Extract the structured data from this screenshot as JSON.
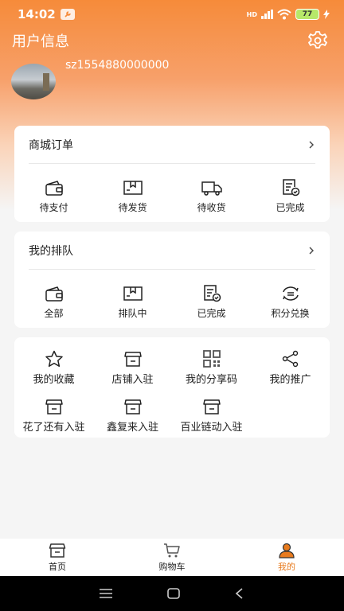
{
  "status_bar": {
    "time": "14:02",
    "network": "HD",
    "battery": "77"
  },
  "header": {
    "title": "用户信息",
    "username": "sz1554880000000"
  },
  "orders": {
    "title": "商城订单",
    "items": [
      {
        "label": "待支付",
        "icon": "wallet-icon"
      },
      {
        "label": "待发货",
        "icon": "box-icon"
      },
      {
        "label": "待收货",
        "icon": "truck-icon"
      },
      {
        "label": "已完成",
        "icon": "checked-doc-icon"
      }
    ]
  },
  "queue": {
    "title": "我的排队",
    "items": [
      {
        "label": "全部",
        "icon": "wallet-icon"
      },
      {
        "label": "排队中",
        "icon": "box-icon"
      },
      {
        "label": "已完成",
        "icon": "checked-doc-icon"
      },
      {
        "label": "积分兑换",
        "icon": "exchange-icon"
      }
    ]
  },
  "services": {
    "row1": [
      {
        "label": "我的收藏",
        "icon": "star-icon"
      },
      {
        "label": "店铺入驻",
        "icon": "store-icon"
      },
      {
        "label": "我的分享码",
        "icon": "qrcode-icon"
      },
      {
        "label": "我的推广",
        "icon": "share-icon"
      }
    ],
    "row2": [
      {
        "label": "花了还有入驻",
        "icon": "store-icon"
      },
      {
        "label": "鑫复来入驻",
        "icon": "store-icon"
      },
      {
        "label": "百业链动入驻",
        "icon": "store-icon"
      }
    ]
  },
  "nav": {
    "items": [
      {
        "label": "首页",
        "icon": "home-store-icon"
      },
      {
        "label": "购物车",
        "icon": "cart-icon"
      },
      {
        "label": "我的",
        "icon": "person-icon"
      }
    ],
    "active_color": "#e87b1e"
  },
  "colors": {
    "accent": "#f68b3a",
    "active": "#e87b1e"
  }
}
